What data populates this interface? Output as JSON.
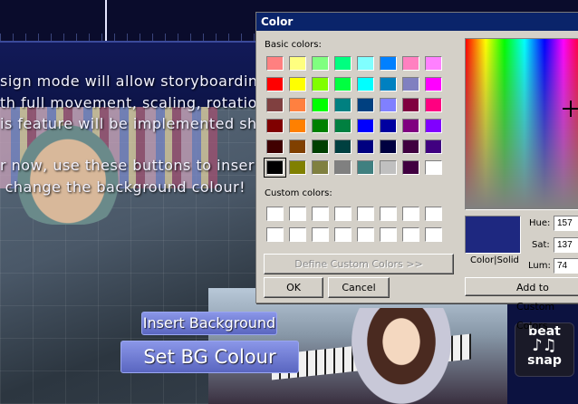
{
  "stage": {
    "paragraph1": "sign mode will allow storyboardin\nth full movement, scaling, rotation\nis feature will be implemented sho",
    "paragraph2": "r now, use these buttons to inser\n change the background colour!",
    "insert_background": "Insert Background",
    "set_bg_colour": "Set BG Colour",
    "beat_snap_line1": "beat",
    "beat_snap_line2": "snap"
  },
  "dialog": {
    "title": "Color",
    "basic_colors_label": "Basic colors:",
    "custom_colors_label": "Custom colors:",
    "define_custom": "Define Custom Colors >>",
    "ok": "OK",
    "cancel": "Cancel",
    "color_solid_label": "Color|Solid",
    "hue_label": "Hue:",
    "sat_label": "Sat:",
    "lum_label": "Lum:",
    "hue_value": "157",
    "sat_value": "137",
    "lum_value": "74",
    "add_to_custom": "Add to Custom Colors",
    "current_color": "#1e2880",
    "basic_colors": [
      [
        "#ff8080",
        "#ffff80",
        "#80ff80",
        "#00ff80",
        "#80ffff",
        "#0080ff",
        "#ff80c0",
        "#ff80ff"
      ],
      [
        "#ff0000",
        "#ffff00",
        "#80ff00",
        "#00ff40",
        "#00ffff",
        "#0080c0",
        "#8080c0",
        "#ff00ff"
      ],
      [
        "#804040",
        "#ff8040",
        "#00ff00",
        "#008080",
        "#004080",
        "#8080ff",
        "#800040",
        "#ff0080"
      ],
      [
        "#800000",
        "#ff8000",
        "#008000",
        "#008040",
        "#0000ff",
        "#0000a0",
        "#800080",
        "#8000ff"
      ],
      [
        "#400000",
        "#804000",
        "#004000",
        "#004040",
        "#000080",
        "#000040",
        "#400040",
        "#400080"
      ],
      [
        "#000000",
        "#808000",
        "#808040",
        "#808080",
        "#408080",
        "#c0c0c0",
        "#400040",
        "#ffffff"
      ]
    ],
    "selected_basic_index": [
      5,
      0
    ],
    "custom_colors": [
      [
        "#ffffff",
        "#ffffff",
        "#ffffff",
        "#ffffff",
        "#ffffff",
        "#ffffff",
        "#ffffff",
        "#ffffff"
      ],
      [
        "#ffffff",
        "#ffffff",
        "#ffffff",
        "#ffffff",
        "#ffffff",
        "#ffffff",
        "#ffffff",
        "#ffffff"
      ]
    ]
  }
}
